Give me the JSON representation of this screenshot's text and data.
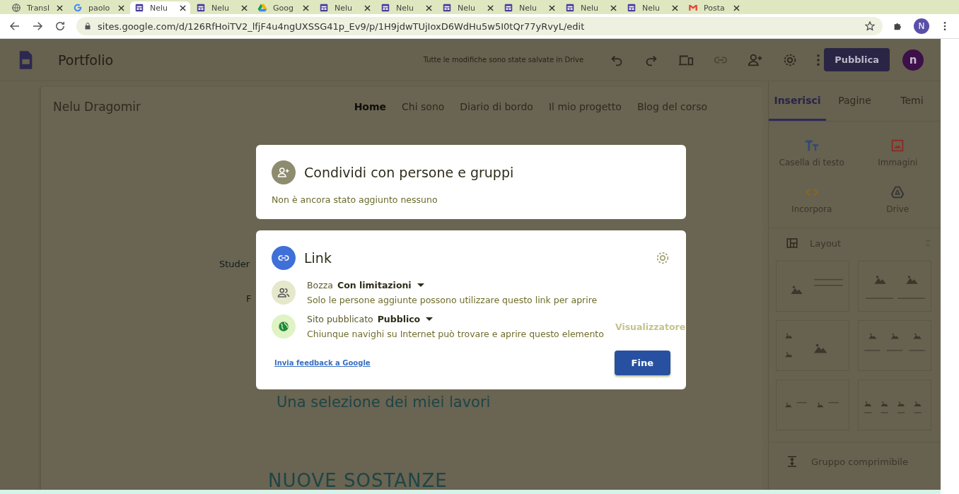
{
  "browser": {
    "tabs": [
      {
        "label": "Transl",
        "kind": "globe",
        "selected": false
      },
      {
        "label": "paolo",
        "kind": "google",
        "selected": false
      },
      {
        "label": "Nelu",
        "kind": "sites",
        "selected": true
      },
      {
        "label": "Nelu",
        "kind": "sites",
        "selected": false
      },
      {
        "label": "Goog",
        "kind": "drive",
        "selected": false
      },
      {
        "label": "Nelu",
        "kind": "sites",
        "selected": false
      },
      {
        "label": "Nelu",
        "kind": "sites",
        "selected": false
      },
      {
        "label": "Nelu",
        "kind": "sites",
        "selected": false
      },
      {
        "label": "Nelu",
        "kind": "sites",
        "selected": false
      },
      {
        "label": "Nelu",
        "kind": "sites",
        "selected": false
      },
      {
        "label": "Nelu",
        "kind": "sites",
        "selected": false
      },
      {
        "label": "Posta",
        "kind": "gmail",
        "selected": false
      }
    ],
    "address": "sites.google.com/d/126RfHoiTV2_lfjF4u4ngUXSSG41p_Ev9/p/1H9jdwTUjIoxD6WdHu5w5I0tQr77yRvyL/edit",
    "profile_initial": "N"
  },
  "app": {
    "title": "Portfolio",
    "save_status": "Tutte le modifiche sono state salvate in Drive",
    "publish_button": "Pubblica",
    "avatar_initial": "n"
  },
  "site": {
    "name": "Nelu Dragomir",
    "nav": [
      {
        "label": "Home",
        "selected": true
      },
      {
        "label": "Chi sono",
        "selected": false
      },
      {
        "label": "Diario di bordo",
        "selected": false
      },
      {
        "label": "Il mio progetto",
        "selected": false
      },
      {
        "label": "Blog del corso",
        "selected": false
      }
    ],
    "fragments": [
      "Studer",
      "F"
    ],
    "subtitle": "Una selezione dei miei lavori",
    "heading": "NUOVE SOSTANZE"
  },
  "side_panel": {
    "tabs": [
      {
        "label": "Inserisci",
        "selected": true
      },
      {
        "label": "Pagine",
        "selected": false
      },
      {
        "label": "Temi",
        "selected": false
      }
    ],
    "insert_items": [
      {
        "label": "Casella di testo",
        "kind": "text"
      },
      {
        "label": "Immagini",
        "kind": "image"
      },
      {
        "label": "Incorpora",
        "kind": "embed"
      },
      {
        "label": "Drive",
        "kind": "drive"
      }
    ],
    "layout_label": "Layout",
    "layouts": [
      {
        "kind": "image-text"
      },
      {
        "kind": "two-images"
      },
      {
        "kind": "mixed-three"
      },
      {
        "kind": "three-columns"
      },
      {
        "kind": "two-image-text"
      },
      {
        "kind": "four-columns"
      }
    ],
    "collapsible": "Gruppo comprimibile"
  },
  "share_dialog": {
    "people": {
      "title": "Condividi con persone e gruppi",
      "empty_text": "Non è ancora stato aggiunto nessuno"
    },
    "link": {
      "title": "Link",
      "rows": [
        {
          "kind": "people",
          "label": "Bozza",
          "value": "Con limitazioni",
          "description": "Solo le persone aggiunte possono utilizzare questo link per aprire"
        },
        {
          "kind": "globe",
          "label": "Sito pubblicato",
          "value": "Pubblico",
          "description": "Chiunque navighi su Internet può trovare e aprire questo elemento",
          "role": "Visualizzatore"
        }
      ],
      "feedback_link": "Invia feedback a Google",
      "done_button": "Fine"
    }
  }
}
